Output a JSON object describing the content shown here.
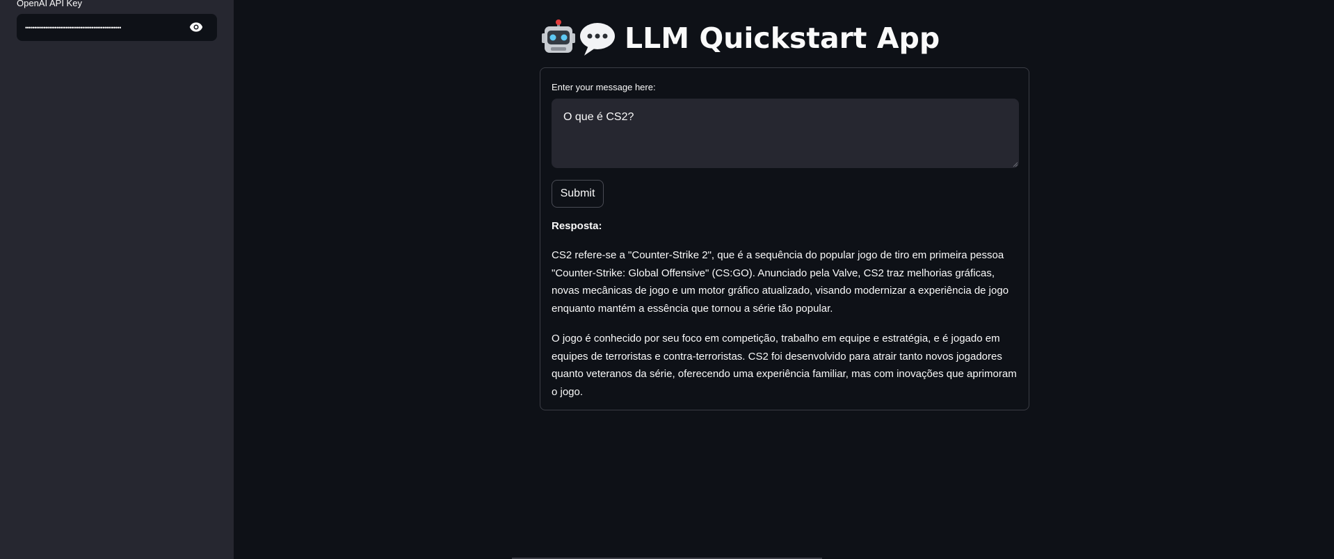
{
  "sidebar": {
    "api_key_label": "OpenAI API Key",
    "api_key_value": "••••••••••••••••••••••••••••••••••••••••••••••••••••",
    "reveal_icon": "eye-icon"
  },
  "header": {
    "title_text": "LLM Quickstart App",
    "title_icons": [
      "robot-emoji-icon",
      "speech-bubble-emoji-icon"
    ]
  },
  "form": {
    "message_label": "Enter your message here:",
    "message_value": "O que é CS2?",
    "submit_label": "Submit"
  },
  "response": {
    "heading": "Resposta:",
    "paragraphs": [
      "CS2 refere-se a \"Counter-Strike 2\", que é a sequência do popular jogo de tiro em primeira pessoa \"Counter-Strike: Global Offensive\" (CS:GO). Anunciado pela Valve, CS2 traz melhorias gráficas, novas mecânicas de jogo e um motor gráfico atualizado, visando modernizar a experiência de jogo enquanto mantém a essência que tornou a série tão popular.",
      "O jogo é conhecido por seu foco em competição, trabalho em equipe e estratégia, e é jogado em equipes de terroristas e contra-terroristas. CS2 foi desenvolvido para atrair tanto novos jogadores quanto veteranos da série, oferecendo uma experiência familiar, mas com inovações que aprimoram o jogo."
    ]
  },
  "colors": {
    "background": "#0e1117",
    "sidebar": "#262730",
    "text": "#fafafa",
    "border": "#3b3d45"
  }
}
